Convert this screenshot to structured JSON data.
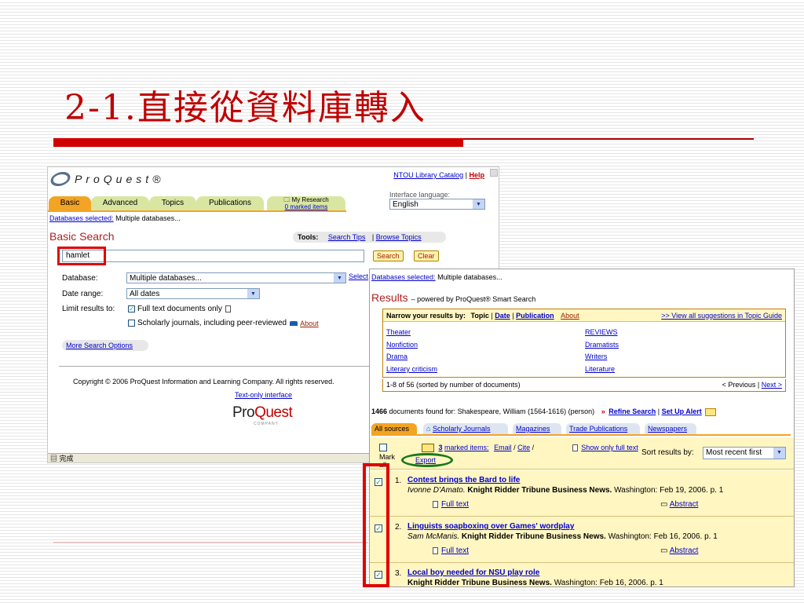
{
  "slide": {
    "title": "2-1.直接從資料庫轉入"
  },
  "proquest": {
    "logo": "ProQuest®",
    "top_links": {
      "catalog": "NTOU Library Catalog",
      "help": "Help"
    },
    "interface_language_label": "Interface language:",
    "interface_language": "English",
    "tabs": [
      "Basic",
      "Advanced",
      "Topics",
      "Publications"
    ],
    "my_research": {
      "label": "My Research",
      "marked": "0 marked items"
    },
    "databases_selected_label": "Databases selected:",
    "databases_selected_value": "Multiple databases...",
    "heading": "Basic Search",
    "tools": {
      "label": "Tools:",
      "search_tips": "Search Tips",
      "browse_topics": "Browse Topics"
    },
    "search_value": "hamlet",
    "search_button": "Search",
    "clear_button": "Clear",
    "database_label": "Database:",
    "database_value": "Multiple databases...",
    "select_databases": "Select",
    "date_range_label": "Date range:",
    "date_range_value": "All dates",
    "limit_label": "Limit results to:",
    "full_text_only": "Full text documents only",
    "scholarly_only": "Scholarly journals, including peer-reviewed",
    "about": "About",
    "more_options": "More Search Options",
    "copyright": "Copyright © 2006 ProQuest Information and Learning Company. All rights reserved.",
    "text_only": "Text-only interface",
    "footer_logo_a": "Pro",
    "footer_logo_b": "Quest",
    "footer_logo_sub": "COMPANY",
    "status": "完成"
  },
  "results": {
    "databases_selected_label": "Databases selected:",
    "databases_selected_value": "Multiple databases...",
    "heading": "Results",
    "powered_by": "– powered by ProQuest® Smart Search",
    "narrow_label": "Narrow your results by:",
    "narrow_topic": "Topic",
    "narrow_date": "Date",
    "narrow_publication": "Publication",
    "narrow_about": "About",
    "view_all": ">> View all suggestions in Topic Guide",
    "topics_left": [
      "Theater",
      "Nonfiction",
      "Drama",
      "Literary criticism"
    ],
    "topics_right": [
      "REVIEWS",
      "Dramatists",
      "Writers",
      "Literature"
    ],
    "range_text": "1-8 of 56 (sorted by number of documents)",
    "prev": "< Previous",
    "next": "Next >",
    "found_count": "1466",
    "found_text": "documents found for: Shakespeare, William (1564-1616) (person)",
    "refine": "Refine Search",
    "alert": "Set Up Alert",
    "source_tabs": [
      "All sources",
      "Scholarly Journals",
      "Magazines",
      "Trade Publications",
      "Newspapers"
    ],
    "mark_all": "Mark all",
    "marked_count": "3",
    "marked_items": "marked items:",
    "email": "Email",
    "cite": "Cite",
    "export": "Export",
    "show_full": "Show only full text",
    "sort_label": "Sort results by:",
    "sort_value": "Most recent first",
    "items": [
      {
        "num": "1.",
        "title": "Contest brings the Bard to life",
        "author": "Ivonne D'Amato.",
        "pub": "Knight Ridder Tribune Business News.",
        "loc": "Washington: Feb 19, 2006. p. 1",
        "full_text": "Full text",
        "abstract": "Abstract"
      },
      {
        "num": "2.",
        "title": "Linguists soapboxing over Games' wordplay",
        "author": "Sam McManis.",
        "pub": "Knight Ridder Tribune Business News.",
        "loc": "Washington: Feb 16, 2006. p. 1",
        "full_text": "Full text",
        "abstract": "Abstract"
      },
      {
        "num": "3.",
        "title": "Local boy needed for NSU play role",
        "author": "",
        "pub": "Knight Ridder Tribune Business News.",
        "loc": "Washington: Feb 16, 2006. p. 1",
        "full_text": "",
        "abstract": ""
      }
    ]
  }
}
